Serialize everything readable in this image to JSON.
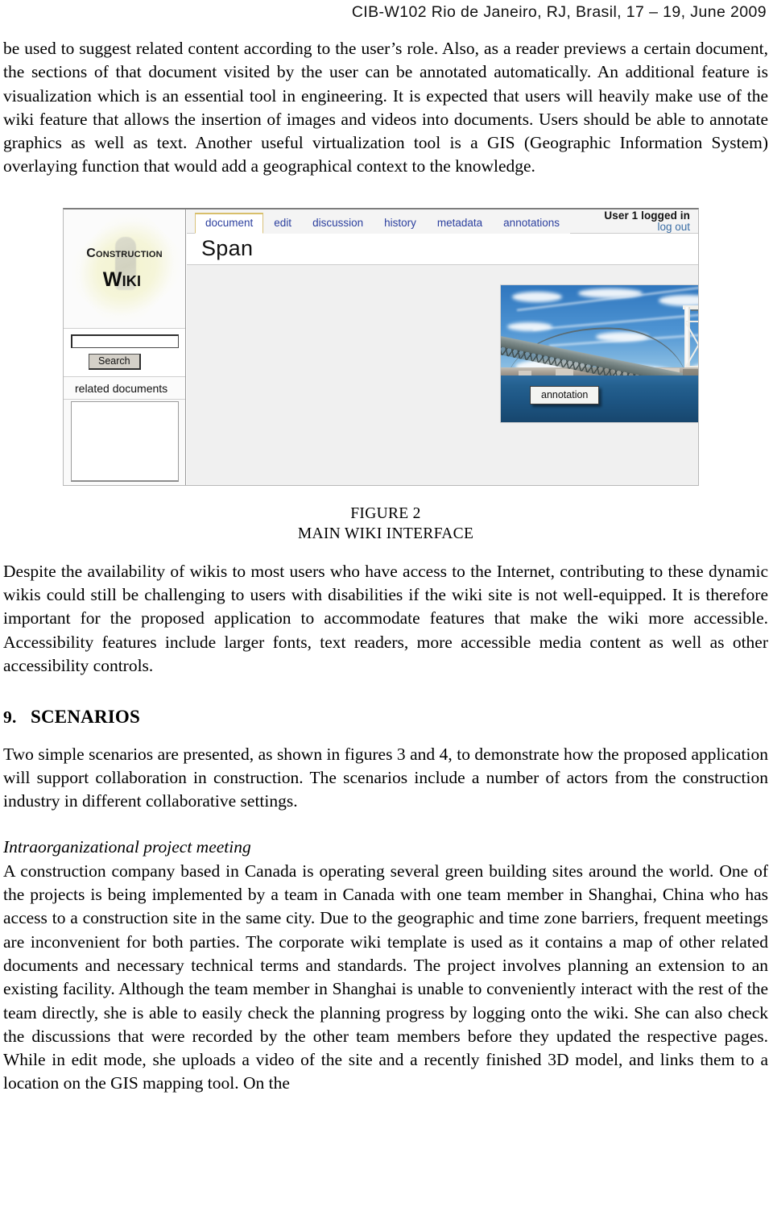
{
  "header": {
    "running_head": "CIB-W102 Rio de Janeiro, RJ, Brasil,  17 – 19, June  2009"
  },
  "body": {
    "paragraph_1": "be used to suggest related content according to the user’s role. Also, as a reader previews a certain document, the sections of that document visited by the user can be annotated automatically. An additional feature is visualization which is an essential tool in engineering. It is expected that users will heavily make use of the wiki feature that allows the insertion of images and videos into documents. Users should be able to annotate graphics as well as text. Another useful virtualization tool is a GIS (Geographic Information System) overlaying function that would add a geographical context to the knowledge.",
    "paragraph_2": "Despite the availability of wikis to most users who have access to the Internet, contributing to these dynamic wikis could still be challenging to users with disabilities if the wiki site is not well-equipped. It is therefore important for the proposed application to accommodate features that make the wiki more accessible. Accessibility features include larger fonts, text readers, more accessible media content as well as other accessibility controls.",
    "section_number": "9.",
    "section_title": "SCENARIOS",
    "paragraph_3": "Two simple scenarios are presented, as shown in figures 3 and 4, to demonstrate how the proposed application will support collaboration in construction. The scenarios include a number of actors from the construction industry in different collaborative settings.",
    "subheading": "Intraorganizational project meeting",
    "paragraph_4": "A construction company based in Canada is operating several green building sites around the world. One of the projects is being implemented by a team in Canada with one team member in Shanghai, China who has access to a construction site in the same city. Due to the geographic and time zone barriers, frequent meetings are inconvenient for both parties. The corporate wiki template is used as it contains a map of other related documents and necessary technical terms and standards. The project involves planning an extension to an existing facility. Although the team member in Shanghai is unable to conveniently interact with the rest of the team directly, she is able to easily check the planning progress by logging onto the wiki. She can also check the discussions that were recorded by the other team members before they updated the respective pages. While in edit mode, she uploads a video of the site and a recently finished 3D model, and links them to a location on the GIS mapping tool. On the"
  },
  "figure": {
    "caption_line1": "FIGURE 2",
    "caption_line2": "MAIN WIKI INTERFACE",
    "screenshot": {
      "logo": {
        "line1": "Construction",
        "line2": "Wiki"
      },
      "search": {
        "value": "",
        "placeholder": "",
        "button_label": "Search"
      },
      "related_documents_label": "related documents",
      "tabs": [
        {
          "label": "document",
          "active": true
        },
        {
          "label": "edit",
          "active": false
        },
        {
          "label": "discussion",
          "active": false
        },
        {
          "label": "history",
          "active": false
        },
        {
          "label": "metadata",
          "active": false
        },
        {
          "label": "annotations",
          "active": false
        }
      ],
      "user": {
        "status": "User 1 logged in",
        "logout_label": "log out"
      },
      "document_title": "Span",
      "photo": {
        "annotation_label": "annotation",
        "alt": "suspension bridge over water"
      },
      "colors": {
        "tab_link": "#2b3f9e",
        "active_tab_border": "#d8bf6b",
        "logout_link": "#3b6ea5",
        "content_bg": "#f0f0f0",
        "logo_glow": "#f5f5d9"
      }
    }
  }
}
